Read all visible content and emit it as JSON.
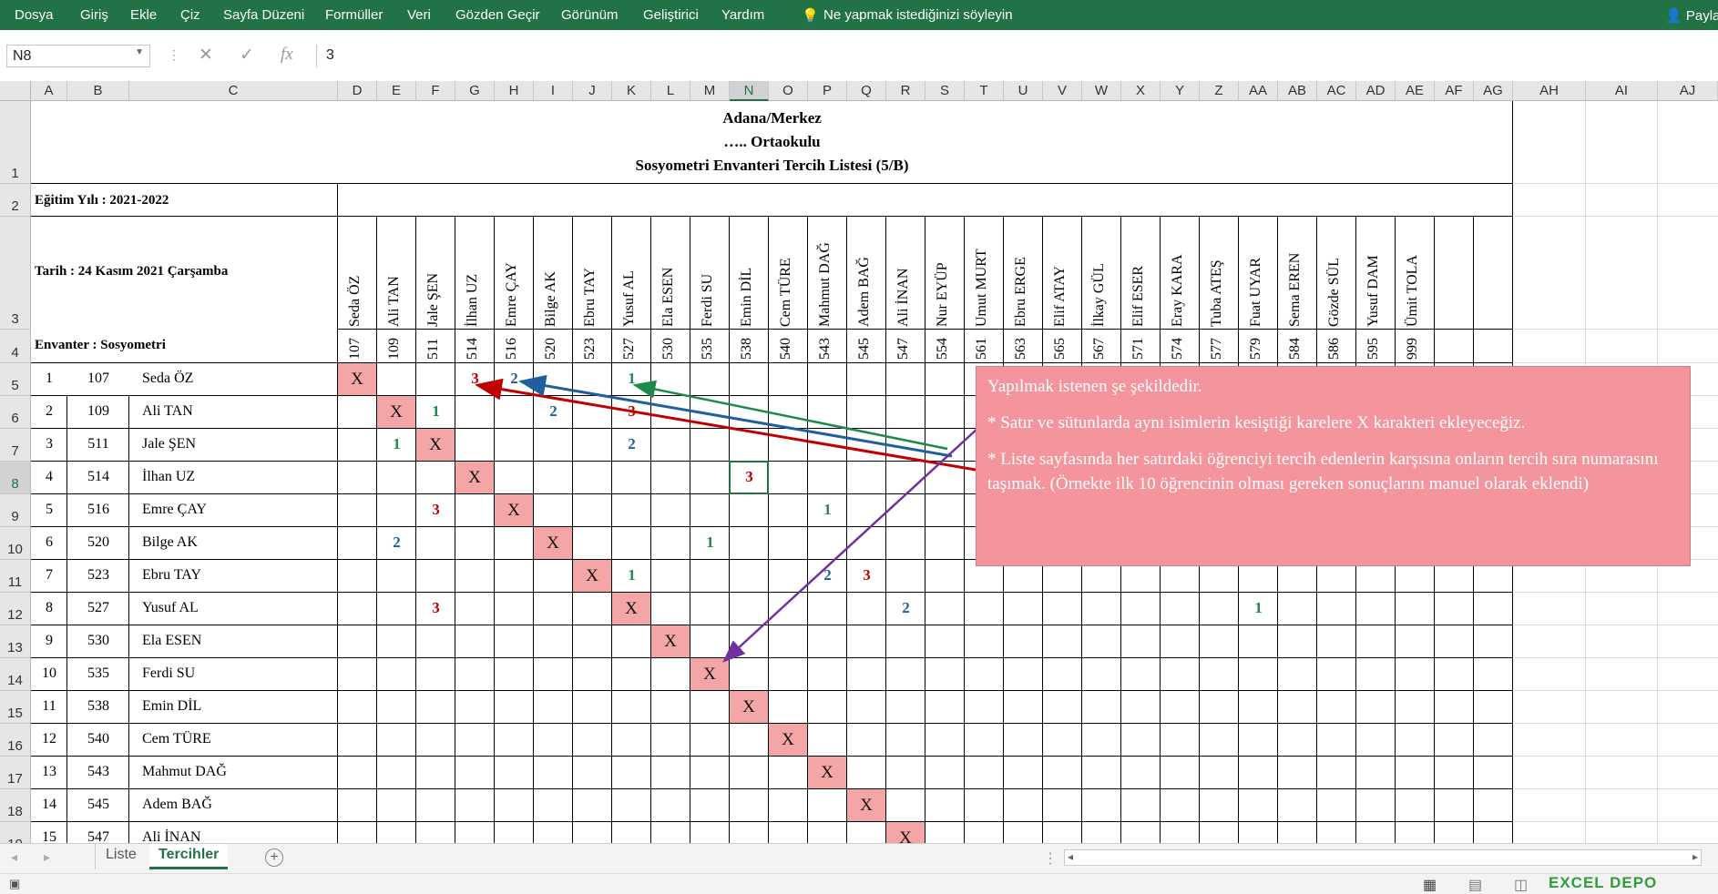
{
  "ribbon": {
    "tabs": [
      "Dosya",
      "Giriş",
      "Ekle",
      "Çiz",
      "Sayfa Düzeni",
      "Formüller",
      "Veri",
      "Gözden Geçir",
      "Görünüm",
      "Geliştirici",
      "Yardım"
    ],
    "tell_me": "Ne yapmak istediğinizi söyleyin",
    "share": "Payla"
  },
  "formula_bar": {
    "name_box": "N8",
    "value": "3"
  },
  "columns": [
    "A",
    "B",
    "C",
    "D",
    "E",
    "F",
    "G",
    "H",
    "I",
    "J",
    "K",
    "L",
    "M",
    "N",
    "O",
    "P",
    "Q",
    "R",
    "S",
    "T",
    "U",
    "V",
    "W",
    "X",
    "Y",
    "Z",
    "AA",
    "AB",
    "AC",
    "AD",
    "AE",
    "AF",
    "AG",
    "AH",
    "AI",
    "AJ"
  ],
  "rows": [
    "1",
    "2",
    "3",
    "4",
    "5",
    "6",
    "7",
    "8",
    "9",
    "10",
    "11",
    "12",
    "13",
    "14",
    "15",
    "16",
    "17",
    "18",
    "19"
  ],
  "header": {
    "line1": "Adana/Merkez",
    "line2": "….. Ortaokulu",
    "line3": "Sosyometri Envanteri Tercih Listesi (5/B)",
    "year": "Eğitim Yılı : 2021-2022",
    "date": "Tarih : 24 Kasım 2021 Çarşamba",
    "inventory": "Envanter : Sosyometri"
  },
  "col_students": [
    {
      "no": "107",
      "name": "Seda ÖZ"
    },
    {
      "no": "109",
      "name": "Ali TAN"
    },
    {
      "no": "511",
      "name": "Jale ŞEN"
    },
    {
      "no": "514",
      "name": "İlhan UZ"
    },
    {
      "no": "516",
      "name": "Emre ÇAY"
    },
    {
      "no": "520",
      "name": "Bilge AK"
    },
    {
      "no": "523",
      "name": "Ebru TAY"
    },
    {
      "no": "527",
      "name": "Yusuf AL"
    },
    {
      "no": "530",
      "name": "Ela ESEN"
    },
    {
      "no": "535",
      "name": "Ferdi SU"
    },
    {
      "no": "538",
      "name": "Emin DİL"
    },
    {
      "no": "540",
      "name": "Cem TÜRE"
    },
    {
      "no": "543",
      "name": "Mahmut DAĞ"
    },
    {
      "no": "545",
      "name": "Adem BAĞ"
    },
    {
      "no": "547",
      "name": "Ali İNAN"
    },
    {
      "no": "554",
      "name": "Nur EYÜP"
    },
    {
      "no": "561",
      "name": "Umut MURT"
    },
    {
      "no": "563",
      "name": "Ebru ERGE"
    },
    {
      "no": "565",
      "name": "Elif ATAY"
    },
    {
      "no": "567",
      "name": "İlkay GÜL"
    },
    {
      "no": "571",
      "name": "Elif ESER"
    },
    {
      "no": "574",
      "name": "Eray KARA"
    },
    {
      "no": "577",
      "name": "Tuba ATEŞ"
    },
    {
      "no": "579",
      "name": "Fuat UYAR"
    },
    {
      "no": "584",
      "name": "Sema EREN"
    },
    {
      "no": "586",
      "name": "Gözde SÜL"
    },
    {
      "no": "595",
      "name": "Yusuf DAM"
    },
    {
      "no": "999",
      "name": "Ümit TOLA"
    }
  ],
  "row_students": [
    {
      "i": "1",
      "no": "107",
      "name": "Seda ÖZ"
    },
    {
      "i": "2",
      "no": "109",
      "name": "Ali TAN"
    },
    {
      "i": "3",
      "no": "511",
      "name": "Jale ŞEN"
    },
    {
      "i": "4",
      "no": "514",
      "name": "İlhan UZ"
    },
    {
      "i": "5",
      "no": "516",
      "name": "Emre ÇAY"
    },
    {
      "i": "6",
      "no": "520",
      "name": "Bilge AK"
    },
    {
      "i": "7",
      "no": "523",
      "name": "Ebru TAY"
    },
    {
      "i": "8",
      "no": "527",
      "name": "Yusuf AL"
    },
    {
      "i": "9",
      "no": "530",
      "name": "Ela ESEN"
    },
    {
      "i": "10",
      "no": "535",
      "name": "Ferdi SU"
    },
    {
      "i": "11",
      "no": "538",
      "name": "Emin DİL"
    },
    {
      "i": "12",
      "no": "540",
      "name": "Cem TÜRE"
    },
    {
      "i": "13",
      "no": "543",
      "name": "Mahmut DAĞ"
    },
    {
      "i": "14",
      "no": "545",
      "name": "Adem BAĞ"
    },
    {
      "i": "15",
      "no": "547",
      "name": "Ali İNAN"
    }
  ],
  "x_mark": "X",
  "marks": [
    {
      "r": 0,
      "c": 3,
      "v": "3",
      "color": "#c00000"
    },
    {
      "r": 0,
      "c": 4,
      "v": "2",
      "color": "#1f5f9f"
    },
    {
      "r": 0,
      "c": 7,
      "v": "1",
      "color": "#1e8a4a"
    },
    {
      "r": 1,
      "c": 2,
      "v": "1",
      "color": "#1e8a4a"
    },
    {
      "r": 1,
      "c": 5,
      "v": "2",
      "color": "#1f5f9f"
    },
    {
      "r": 1,
      "c": 7,
      "v": "3",
      "color": "#c00000"
    },
    {
      "r": 2,
      "c": 1,
      "v": "1",
      "color": "#1e8a4a"
    },
    {
      "r": 2,
      "c": 7,
      "v": "2",
      "color": "#1f5f9f"
    },
    {
      "r": 3,
      "c": 10,
      "v": "3",
      "color": "#c00000"
    },
    {
      "r": 4,
      "c": 2,
      "v": "3",
      "color": "#c00000"
    },
    {
      "r": 4,
      "c": 12,
      "v": "1",
      "color": "#1e8a4a"
    },
    {
      "r": 5,
      "c": 1,
      "v": "2",
      "color": "#1f5f9f"
    },
    {
      "r": 5,
      "c": 9,
      "v": "1",
      "color": "#1e8a4a"
    },
    {
      "r": 6,
      "c": 7,
      "v": "1",
      "color": "#1e8a4a"
    },
    {
      "r": 6,
      "c": 12,
      "v": "2",
      "color": "#1f5f9f"
    },
    {
      "r": 6,
      "c": 13,
      "v": "3",
      "color": "#c00000"
    },
    {
      "r": 7,
      "c": 2,
      "v": "3",
      "color": "#c00000"
    },
    {
      "r": 7,
      "c": 14,
      "v": "2",
      "color": "#1f5f9f"
    },
    {
      "r": 7,
      "c": 23,
      "v": "1",
      "color": "#1e8a4a"
    }
  ],
  "note": {
    "line1": "Yapılmak istenen şe şekildedir.",
    "line2": "* Satır ve sütunlarda aynı isimlerin kesiştiği karelere X karakteri ekleyeceğiz.",
    "line3": "* Liste sayfasında her satırdaki öğrenciyi tercih edenlerin karşısına onların tercih sıra numarasını taşımak. (Örnekte ilk 10 öğrencinin olması gereken sonuçlarını manuel olarak eklendi)"
  },
  "sheet_tabs": {
    "tab1": "Liste",
    "tab2": "Tercihler",
    "add": "+"
  },
  "watermark": "EXCEL DEPO",
  "colors": {
    "ribbon": "#217346",
    "x_fill": "#f4a5a5",
    "note_fill": "#f4959d",
    "arrow_red": "#c00000",
    "arrow_blue": "#1f5f9f",
    "arrow_green": "#1e8a4a",
    "arrow_purple": "#7030a0"
  }
}
